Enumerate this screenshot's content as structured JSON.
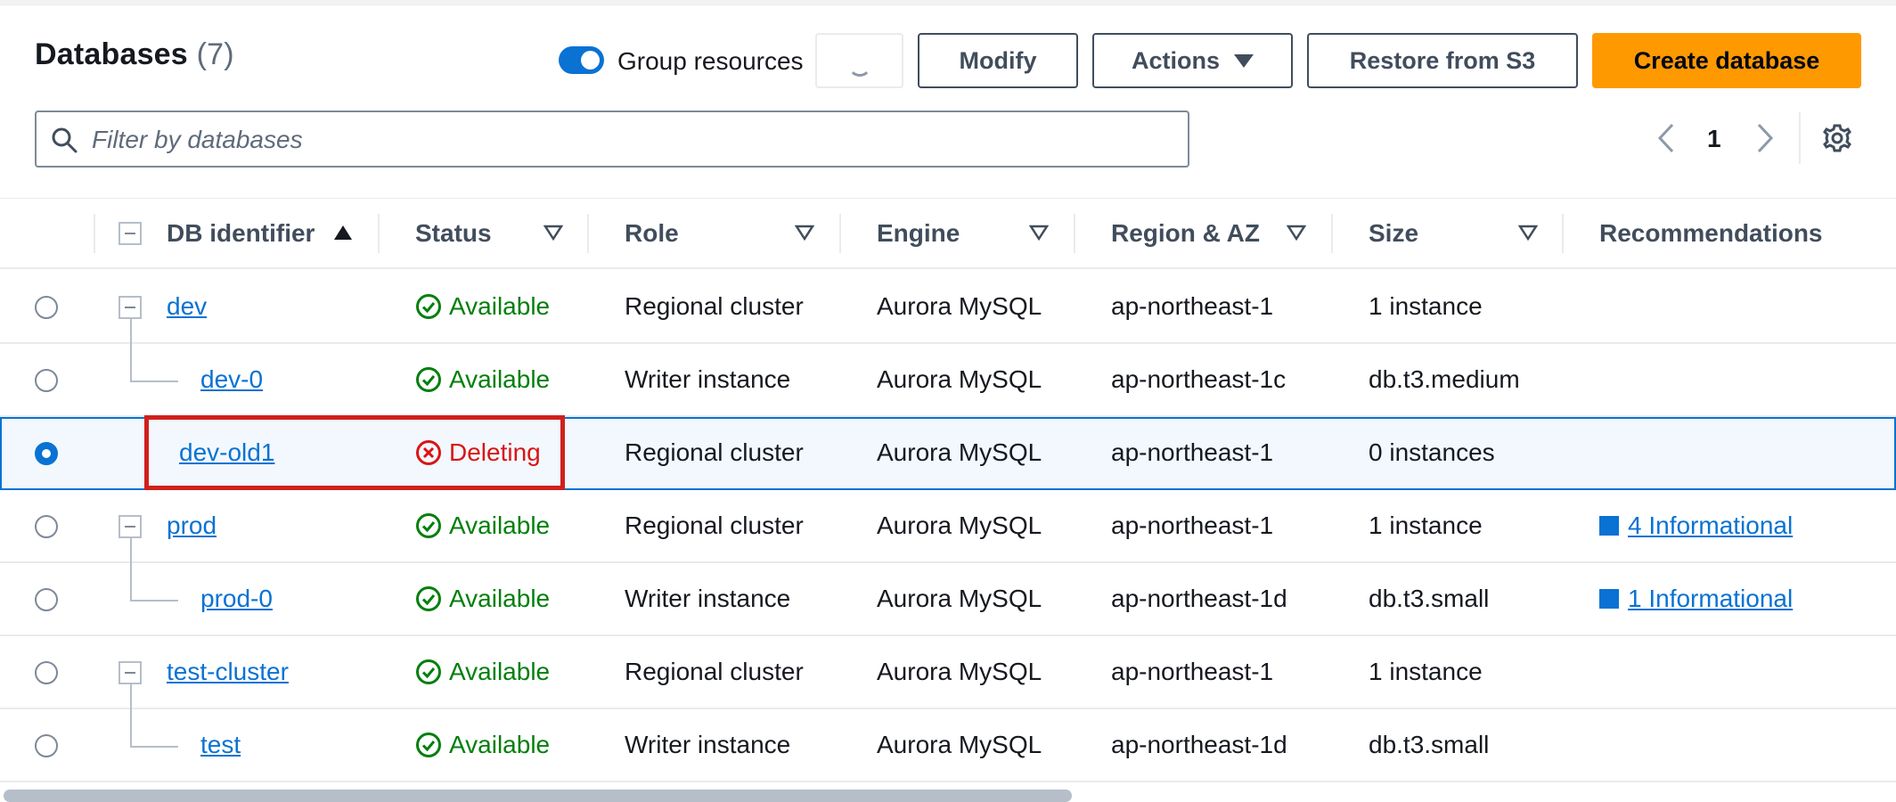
{
  "header": {
    "title": "Databases",
    "count": "(7)",
    "group_toggle_label": "Group resources",
    "group_toggle_on": true
  },
  "toolbar": {
    "refresh_icon": "spinner-icon",
    "modify_label": "Modify",
    "actions_label": "Actions",
    "restore_label": "Restore from S3",
    "create_label": "Create database"
  },
  "search": {
    "placeholder": "Filter by databases",
    "value": ""
  },
  "pagination": {
    "current_page": "1"
  },
  "table": {
    "columns": [
      "DB identifier",
      "Status",
      "Role",
      "Engine",
      "Region & AZ",
      "Size",
      "Recommendations"
    ],
    "rows": [
      {
        "id": "dev",
        "status": "Available",
        "role": "Regional cluster",
        "engine": "Aurora MySQL",
        "region": "ap-northeast-1",
        "size": "1 instance",
        "recommendation": ""
      },
      {
        "id": "dev-0",
        "status": "Available",
        "role": "Writer instance",
        "engine": "Aurora MySQL",
        "region": "ap-northeast-1c",
        "size": "db.t3.medium",
        "recommendation": ""
      },
      {
        "id": "dev-old1",
        "status": "Deleting",
        "role": "Regional cluster",
        "engine": "Aurora MySQL",
        "region": "ap-northeast-1",
        "size": "0 instances",
        "recommendation": ""
      },
      {
        "id": "prod",
        "status": "Available",
        "role": "Regional cluster",
        "engine": "Aurora MySQL",
        "region": "ap-northeast-1",
        "size": "1 instance",
        "recommendation": "4 Informational"
      },
      {
        "id": "prod-0",
        "status": "Available",
        "role": "Writer instance",
        "engine": "Aurora MySQL",
        "region": "ap-northeast-1d",
        "size": "db.t3.small",
        "recommendation": "1 Informational"
      },
      {
        "id": "test-cluster",
        "status": "Available",
        "role": "Regional cluster",
        "engine": "Aurora MySQL",
        "region": "ap-northeast-1",
        "size": "1 instance",
        "recommendation": ""
      },
      {
        "id": "test",
        "status": "Available",
        "role": "Writer instance",
        "engine": "Aurora MySQL",
        "region": "ap-northeast-1d",
        "size": "db.t3.small",
        "recommendation": ""
      }
    ]
  },
  "colors": {
    "accent": "#0972d3",
    "primary_button": "#ff9900",
    "available": "#037f0c",
    "deleting": "#d91515",
    "highlight_box": "#d0201c"
  }
}
